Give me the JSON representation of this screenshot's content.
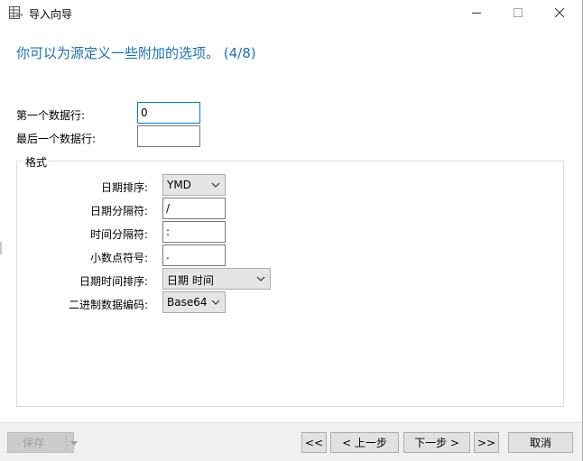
{
  "window": {
    "title": "导入向导",
    "icons": {
      "app": "import-table-icon",
      "minimize": "minimize-icon",
      "maximize": "maximize-icon",
      "close": "close-icon"
    }
  },
  "heading": "你可以为源定义一些附加的选项。 (4/8)",
  "rows": {
    "first_data_row_label": "第一个数据行:",
    "first_data_row_value": "0",
    "last_data_row_label": "最后一个数据行:",
    "last_data_row_value": ""
  },
  "format": {
    "title": "格式",
    "date_order_label": "日期排序:",
    "date_order_value": "YMD",
    "date_sep_label": "日期分隔符:",
    "date_sep_value": "/",
    "time_sep_label": "时间分隔符:",
    "time_sep_value": ":",
    "decimal_label": "小数点符号:",
    "decimal_value": ".",
    "datetime_order_label": "日期时间排序:",
    "datetime_order_value": "日期 时间",
    "binary_encoding_label": "二进制数据编码:",
    "binary_encoding_value": "Base64"
  },
  "footer": {
    "save_label": "保存",
    "first_label": "<<",
    "prev_label": "< 上一步",
    "next_label": "下一步 >",
    "last_label": ">>",
    "cancel_label": "取消"
  },
  "colors": {
    "heading": "#1a6fb5",
    "focus_border": "#0078d7",
    "footer_bg": "#f0f0f0"
  }
}
